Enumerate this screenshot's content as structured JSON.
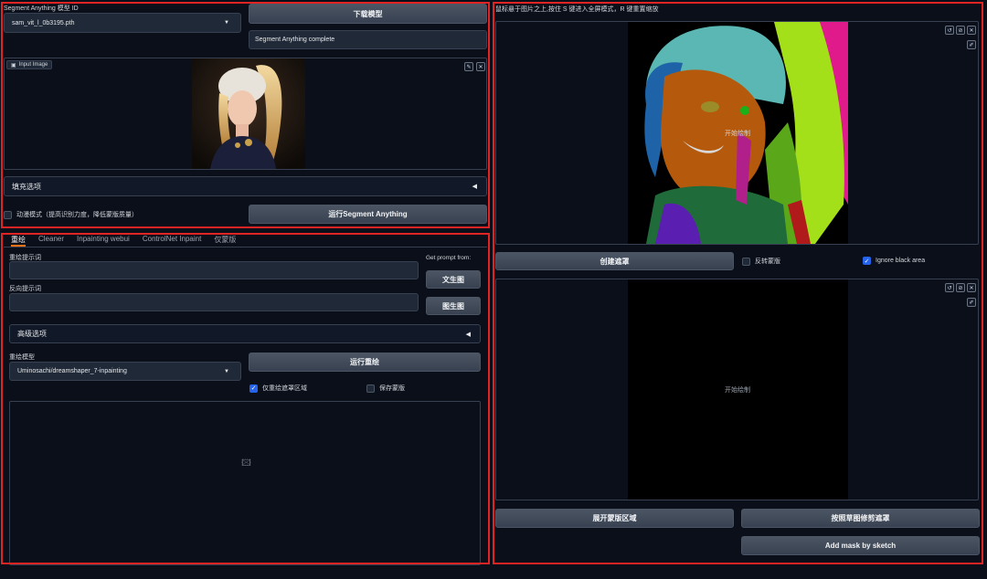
{
  "top_left": {
    "model_id_label": "Segment Anything 模型 ID",
    "model_id_value": "sam_vit_l_0b3195.pth",
    "download_button": "下载模型",
    "status_text": "Segment Anything complete",
    "input_image_label": "Input Image",
    "fill_options_label": "填充选项",
    "anime_mode_label": "动漫模式（提高识别力度，降低蒙版质量）",
    "run_sam_button": "运行Segment Anything"
  },
  "bottom_left": {
    "tabs": [
      {
        "label": "重绘"
      },
      {
        "label": "Cleaner"
      },
      {
        "label": "Inpainting webui"
      },
      {
        "label": "ControlNet Inpaint"
      },
      {
        "label": "仅蒙版"
      }
    ],
    "prompt_label": "重绘提示词",
    "negative_prompt_label": "反向提示词",
    "get_prompt_label": "Get prompt from:",
    "txt2img_button": "文生图",
    "img2img_button": "图生图",
    "advanced_options_label": "高级选项",
    "inpaint_model_label": "重绘模型",
    "inpaint_model_value": "Uminosachi/dreamshaper_7-inpainting",
    "run_inpaint_button": "运行重绘",
    "inpaint_masked_only_label": "仅重绘遮罩区域",
    "save_mask_label": "保存蒙版"
  },
  "right": {
    "hint_text": "鼠标悬于图片之上,按住 S 键进入全屏模式，R 键重置缩放",
    "start_drawing_label_1": "开始绘制",
    "create_mask_button": "创建遮罩",
    "invert_mask_label": "反转蒙版",
    "ignore_black_label": "Ignore black area",
    "start_drawing_label_2": "开始绘制",
    "expand_mask_button": "展开蒙版区域",
    "trim_mask_button": "按照草图修剪遮罩",
    "add_mask_button": "Add mask by sketch"
  },
  "colors": {
    "accent_blue": "#2563eb",
    "highlight_red": "#e02424",
    "tab_underline": "#f97316"
  }
}
